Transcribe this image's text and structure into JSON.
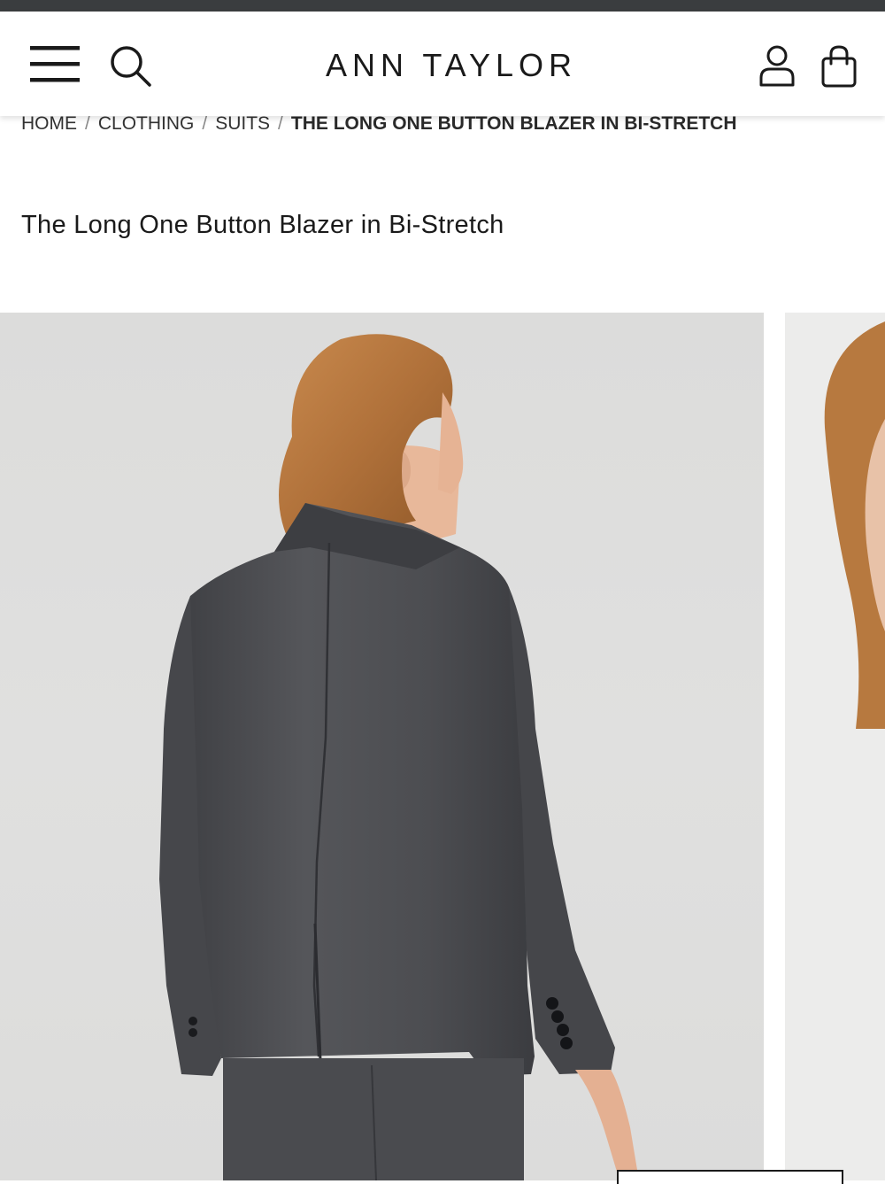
{
  "header": {
    "brand": "ANN TAYLOR",
    "icons": {
      "menu": "hamburger-menu-icon",
      "search": "search-icon",
      "account": "account-icon",
      "bag": "shopping-bag-icon"
    }
  },
  "breadcrumb": {
    "items": [
      "HOME",
      "CLOTHING",
      "SUITS"
    ],
    "separator": "/",
    "current": "THE LONG ONE BUTTON BLAZER IN BI-STRETCH"
  },
  "product": {
    "title": "The Long One Button Blazer in Bi-Stretch"
  },
  "colors": {
    "status_strip": "#3a3d3f",
    "text": "#1a1a1a",
    "photo_background": "#dcdcdb",
    "blazer": "#4d4e52",
    "hair": "#b8783f"
  }
}
